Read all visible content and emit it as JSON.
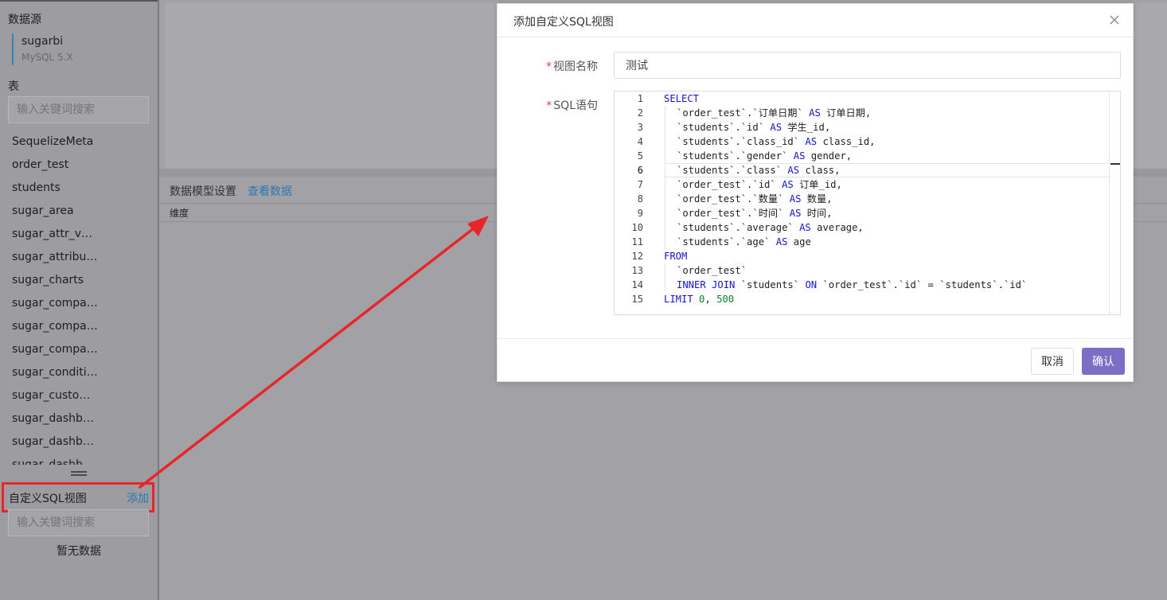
{
  "sidebar": {
    "datasource_title": "数据源",
    "datasource_name": "sugarbi",
    "datasource_type": "MySQL 5.X",
    "tables_title": "表",
    "table_search_placeholder": "输入关键词搜索",
    "tables": [
      "SequelizeMeta",
      "order_test",
      "students",
      "sugar_area",
      "sugar_attr_value",
      "sugar_attributes",
      "sugar_charts",
      "sugar_companies",
      "sugar_company_users",
      "sugar_companys",
      "sugar_conditions",
      "sugar_custom_sqls",
      "sugar_dashboards",
      "sugar_dashboard_items",
      "sugar_dashboard_users"
    ],
    "custom_sql_title": "自定义SQL视图",
    "custom_sql_add": "添加",
    "custom_sql_search_placeholder": "输入关键词搜索",
    "empty_text": "暂无数据"
  },
  "main": {
    "model_settings_label": "数据模型设置",
    "view_data_link": "查看数据",
    "dimension_label": "维度"
  },
  "modal": {
    "title": "添加自定义SQL视图",
    "view_name_label": "视图名称",
    "view_name_value": "测试",
    "sql_label": "SQL语句",
    "cancel_label": "取消",
    "confirm_label": "确认",
    "active_line": 6,
    "code_lines": [
      {
        "n": "1",
        "indent": false,
        "tokens": [
          {
            "t": "SELECT",
            "c": "kw"
          }
        ]
      },
      {
        "n": "2",
        "indent": true,
        "tokens": [
          {
            "t": "`order_test`.`订单日期` ",
            "c": ""
          },
          {
            "t": "AS",
            "c": "kw"
          },
          {
            "t": " 订单日期,",
            "c": ""
          }
        ]
      },
      {
        "n": "3",
        "indent": true,
        "tokens": [
          {
            "t": "`students`.`id` ",
            "c": ""
          },
          {
            "t": "AS",
            "c": "kw"
          },
          {
            "t": " 学生_id,",
            "c": ""
          }
        ]
      },
      {
        "n": "4",
        "indent": true,
        "tokens": [
          {
            "t": "`students`.`class_id` ",
            "c": ""
          },
          {
            "t": "AS",
            "c": "kw"
          },
          {
            "t": " class_id,",
            "c": ""
          }
        ]
      },
      {
        "n": "5",
        "indent": true,
        "tokens": [
          {
            "t": "`students`.`gender` ",
            "c": ""
          },
          {
            "t": "AS",
            "c": "kw"
          },
          {
            "t": " gender,",
            "c": ""
          }
        ]
      },
      {
        "n": "6",
        "indent": true,
        "tokens": [
          {
            "t": "`students`.`class` ",
            "c": ""
          },
          {
            "t": "AS",
            "c": "kw"
          },
          {
            "t": " class,",
            "c": ""
          }
        ]
      },
      {
        "n": "7",
        "indent": true,
        "tokens": [
          {
            "t": "`order_test`.`id` ",
            "c": ""
          },
          {
            "t": "AS",
            "c": "kw"
          },
          {
            "t": " 订单_id,",
            "c": ""
          }
        ]
      },
      {
        "n": "8",
        "indent": true,
        "tokens": [
          {
            "t": "`order_test`.`数量` ",
            "c": ""
          },
          {
            "t": "AS",
            "c": "kw"
          },
          {
            "t": " 数量,",
            "c": ""
          }
        ]
      },
      {
        "n": "9",
        "indent": true,
        "tokens": [
          {
            "t": "`order_test`.`时间` ",
            "c": ""
          },
          {
            "t": "AS",
            "c": "kw"
          },
          {
            "t": " 时间,",
            "c": ""
          }
        ]
      },
      {
        "n": "10",
        "indent": true,
        "tokens": [
          {
            "t": "`students`.`average` ",
            "c": ""
          },
          {
            "t": "AS",
            "c": "kw"
          },
          {
            "t": " average,",
            "c": ""
          }
        ]
      },
      {
        "n": "11",
        "indent": true,
        "tokens": [
          {
            "t": "`students`.`age` ",
            "c": ""
          },
          {
            "t": "AS",
            "c": "kw"
          },
          {
            "t": " age",
            "c": ""
          }
        ]
      },
      {
        "n": "12",
        "indent": false,
        "tokens": [
          {
            "t": "FROM",
            "c": "kw"
          }
        ]
      },
      {
        "n": "13",
        "indent": true,
        "tokens": [
          {
            "t": "`order_test`",
            "c": ""
          }
        ]
      },
      {
        "n": "14",
        "indent": true,
        "tokens": [
          {
            "t": "INNER JOIN",
            "c": "kw"
          },
          {
            "t": " `students` ",
            "c": ""
          },
          {
            "t": "ON",
            "c": "kw"
          },
          {
            "t": " `order_test`.`id` = `students`.`id`",
            "c": ""
          }
        ]
      },
      {
        "n": "15",
        "indent": false,
        "tokens": [
          {
            "t": "LIMIT",
            "c": "kw"
          },
          {
            "t": " ",
            "c": ""
          },
          {
            "t": "0",
            "c": "num"
          },
          {
            "t": ", ",
            "c": ""
          },
          {
            "t": "500",
            "c": "num"
          }
        ]
      }
    ]
  },
  "colors": {
    "accent": "#7c6ec4",
    "link": "#2e78b2",
    "annotation": "#e8262a",
    "keyword": "#1515d0",
    "number": "#0a7d2f"
  }
}
